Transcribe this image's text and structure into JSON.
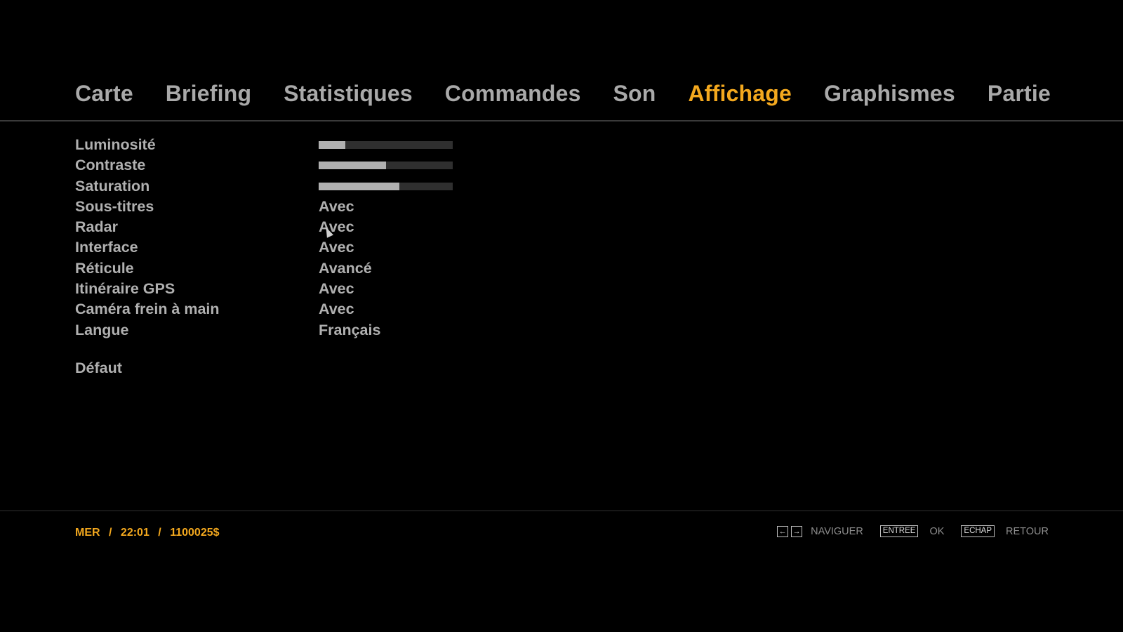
{
  "tabs": [
    {
      "label": "Carte",
      "active": false
    },
    {
      "label": "Briefing",
      "active": false
    },
    {
      "label": "Statistiques",
      "active": false
    },
    {
      "label": "Commandes",
      "active": false
    },
    {
      "label": "Son",
      "active": false
    },
    {
      "label": "Affichage",
      "active": true
    },
    {
      "label": "Graphismes",
      "active": false
    },
    {
      "label": "Partie",
      "active": false
    }
  ],
  "settings": {
    "luminosite": {
      "label": "Luminosité",
      "level": 0.2
    },
    "contraste": {
      "label": "Contraste",
      "level": 0.5
    },
    "saturation": {
      "label": "Saturation",
      "level": 0.6
    },
    "sous_titres": {
      "label": "Sous-titres",
      "value": "Avec"
    },
    "radar": {
      "label": "Radar",
      "value": "Avec"
    },
    "interface": {
      "label": "Interface",
      "value": "Avec"
    },
    "reticule": {
      "label": "Réticule",
      "value": "Avancé"
    },
    "itineraire_gps": {
      "label": "Itinéraire GPS",
      "value": "Avec"
    },
    "camera_frein": {
      "label": "Caméra frein à main",
      "value": "Avec"
    },
    "langue": {
      "label": "Langue",
      "value": "Français"
    }
  },
  "default_label": "Défaut",
  "status": {
    "day": "MER",
    "time": "22:01",
    "money": "1100025$",
    "separator": "/"
  },
  "hints": {
    "left_arrow": "←",
    "right_arrow": "→",
    "navigate_label": "NAVIGUER",
    "enter_key": "ENTREE",
    "ok_label": "OK",
    "escape_key": "ECHAP",
    "back_label": "RETOUR"
  },
  "colors": {
    "accent": "#f3a81e",
    "text": "#b0b0b0",
    "background": "#000000"
  }
}
